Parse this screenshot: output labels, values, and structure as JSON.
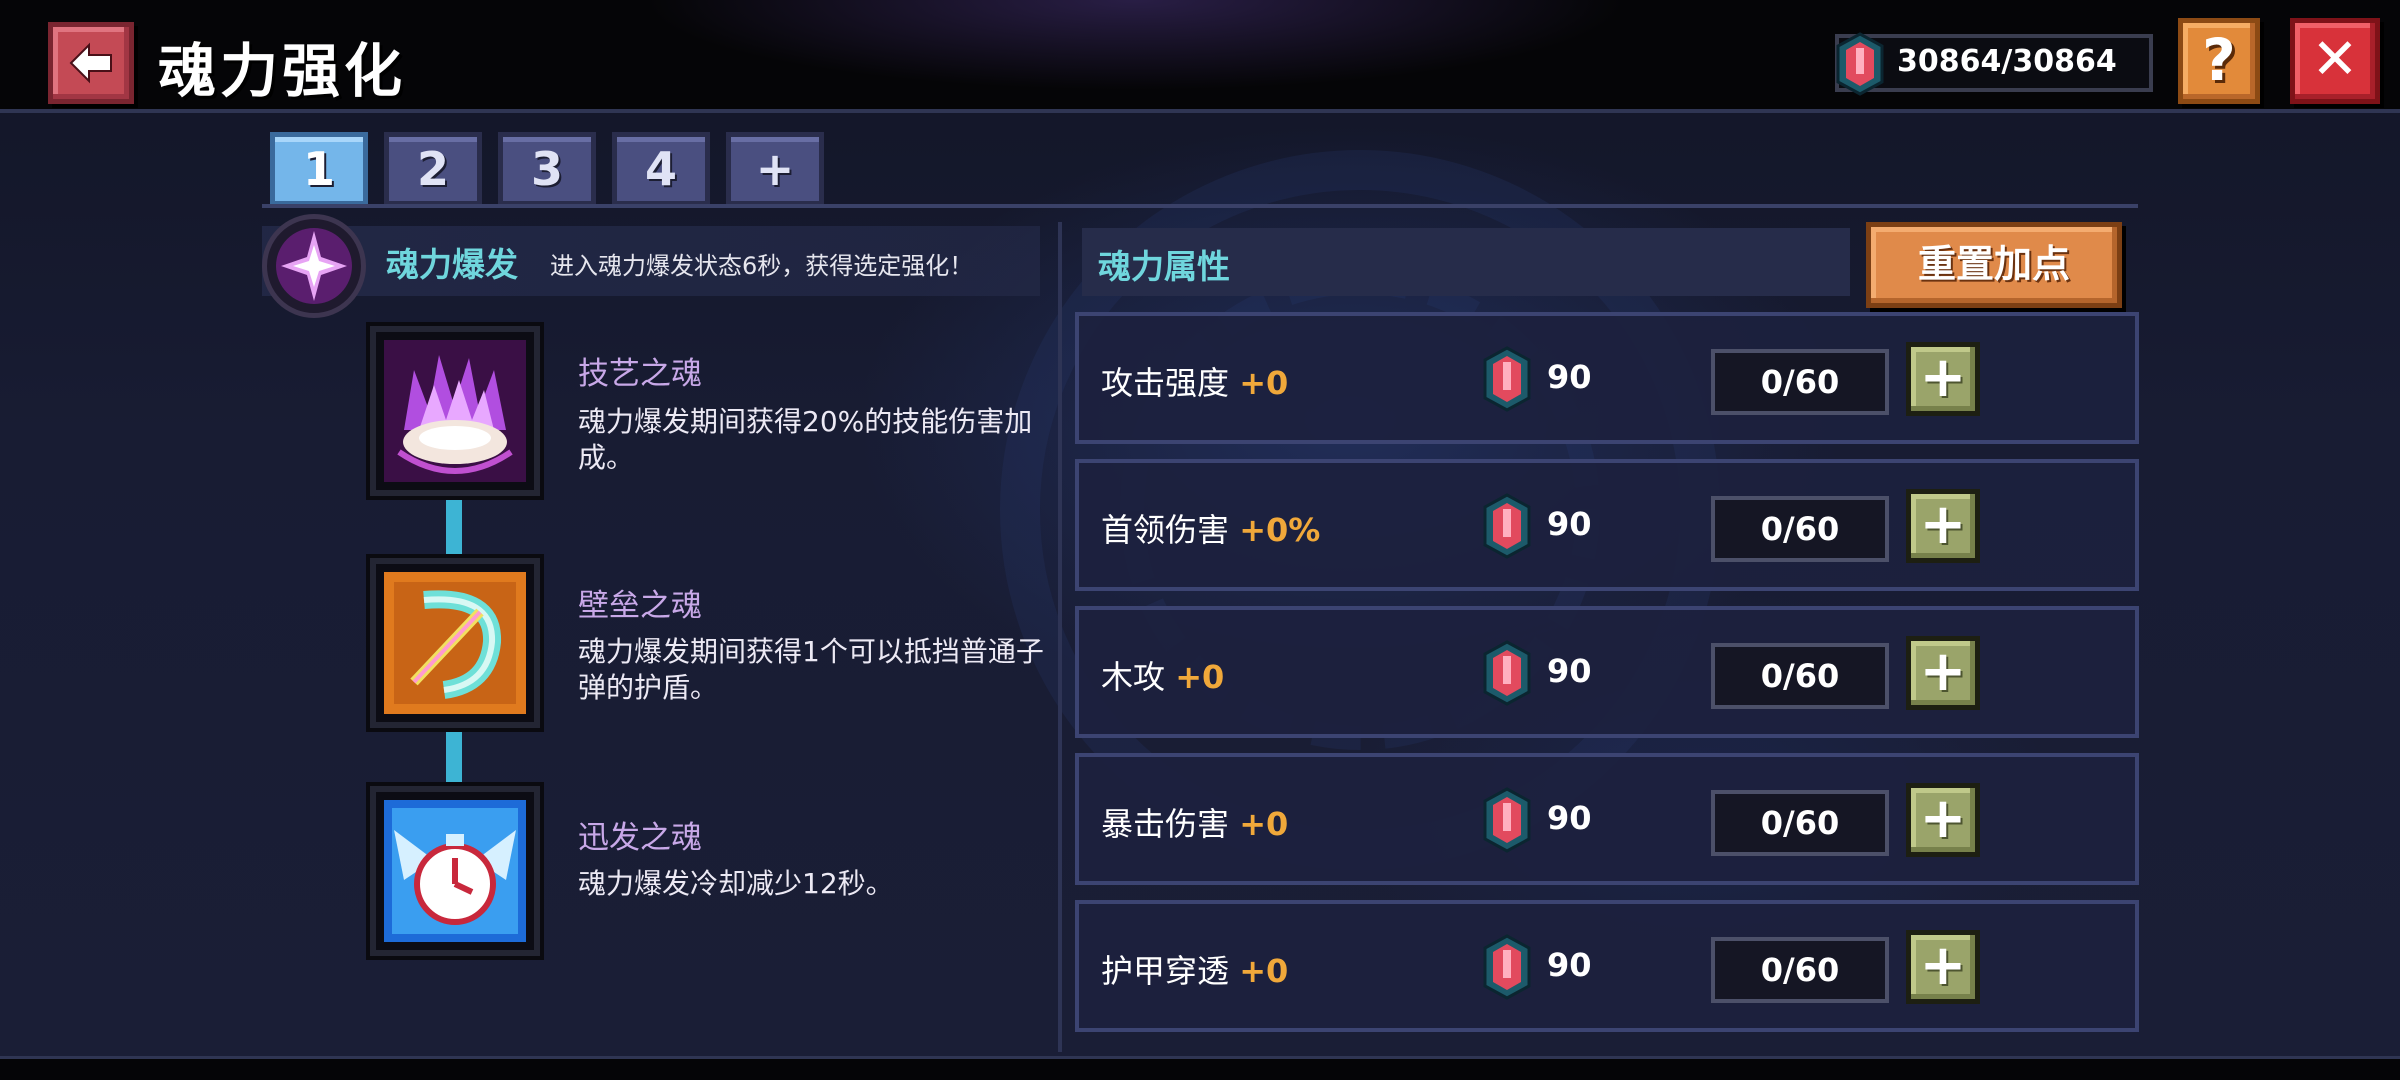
{
  "header": {
    "title": "魂力强化",
    "currency": "30864/30864",
    "help_label": "?",
    "close_label": "✕"
  },
  "tabs": [
    {
      "label": "1",
      "active": true
    },
    {
      "label": "2",
      "active": false
    },
    {
      "label": "3",
      "active": false
    },
    {
      "label": "4",
      "active": false
    },
    {
      "label": "+",
      "active": false
    }
  ],
  "burst": {
    "title": "魂力爆发",
    "desc": "进入魂力爆发状态6秒，获得选定强化！"
  },
  "souls": [
    {
      "name": "技艺之魂",
      "desc": "魂力爆发期间获得20%的技能伤害加成。",
      "icon": "flame-hand-icon"
    },
    {
      "name": "壁垒之魂",
      "desc": "魂力爆发期间获得1个可以抵挡普通子弹的护盾。",
      "icon": "shield-sword-icon"
    },
    {
      "name": "迅发之魂",
      "desc": "魂力爆发冷却减少12秒。",
      "icon": "winged-clock-icon"
    }
  ],
  "attributes": {
    "title": "魂力属性",
    "reset_label": "重置加点",
    "rows": [
      {
        "label": "攻击强度",
        "bonus": "+0",
        "cost": "90",
        "count": "0/60"
      },
      {
        "label": "首领伤害",
        "bonus": "+0%",
        "cost": "90",
        "count": "0/60"
      },
      {
        "label": "木攻",
        "bonus": "+0",
        "cost": "90",
        "count": "0/60"
      },
      {
        "label": "暴击伤害",
        "bonus": "+0",
        "cost": "90",
        "count": "0/60"
      },
      {
        "label": "护甲穿透",
        "bonus": "+0",
        "cost": "90",
        "count": "0/60"
      }
    ],
    "plus_label": "+"
  },
  "colors": {
    "accent_cyan": "#6fd6dd",
    "bonus_orange": "#f0a83a",
    "tab_active": "#74b6ea",
    "tab_inactive": "#4a4f80",
    "reset_orange": "#e08a4a",
    "plus_green": "#9aa46a"
  }
}
